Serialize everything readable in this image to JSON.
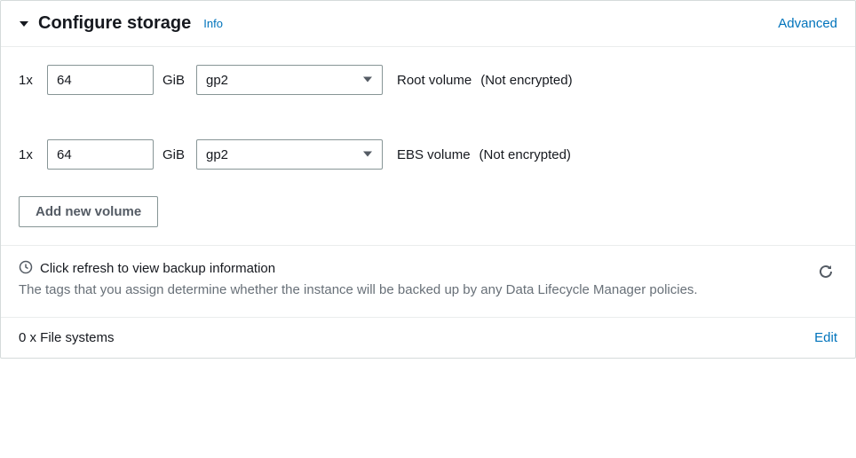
{
  "header": {
    "title": "Configure storage",
    "info_label": "Info",
    "advanced_label": "Advanced"
  },
  "volumes": [
    {
      "count": "1x",
      "size": "64",
      "unit": "GiB",
      "type": "gp2",
      "name": "Root volume",
      "encryption": "(Not encrypted)"
    },
    {
      "count": "1x",
      "size": "64",
      "unit": "GiB",
      "type": "gp2",
      "name": "EBS volume",
      "encryption": "(Not encrypted)"
    }
  ],
  "add_volume_label": "Add new volume",
  "backup": {
    "title": "Click refresh to view backup information",
    "description": "The tags that you assign determine whether the instance will be backed up by any Data Lifecycle Manager policies."
  },
  "filesystems": {
    "text": "0 x File systems",
    "edit_label": "Edit"
  }
}
